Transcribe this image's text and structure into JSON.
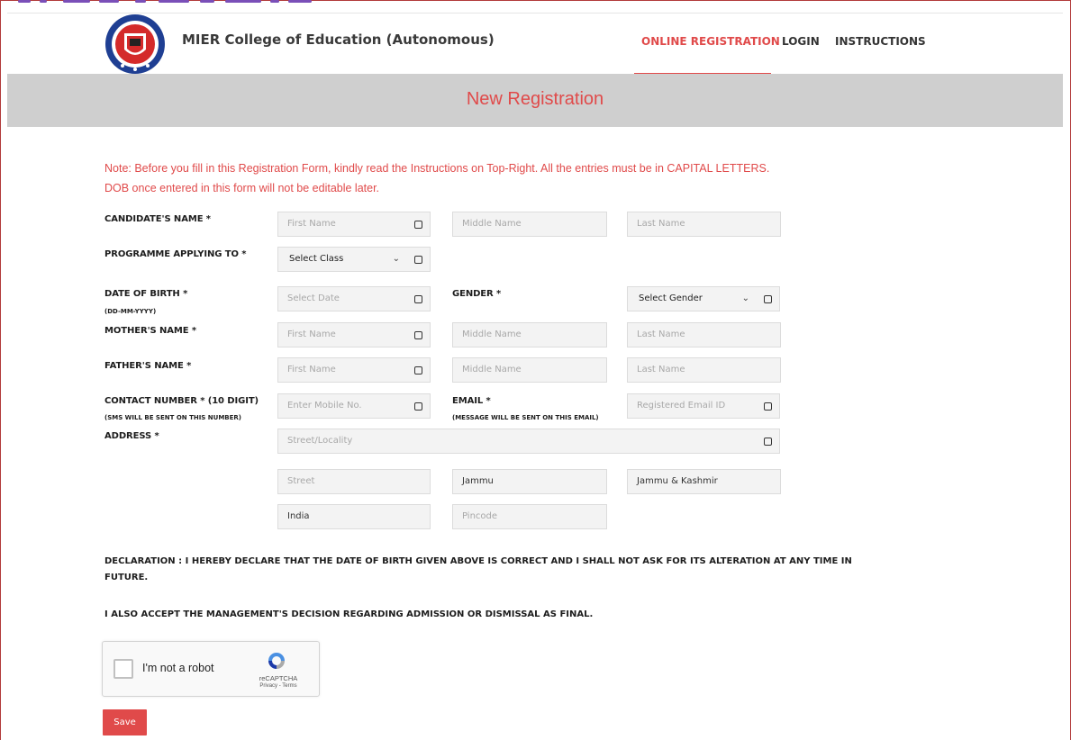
{
  "header": {
    "brand": "MIER College of Education (Autonomous)",
    "nav": [
      {
        "label": "ONLINE REGISTRATION",
        "active": true
      },
      {
        "label": "LOGIN",
        "active": false
      },
      {
        "label": "INSTRUCTIONS",
        "active": false
      }
    ]
  },
  "banner": {
    "title": "New Registration"
  },
  "note": {
    "line1": "Note: Before you fill in this Registration Form, kindly read the Instructions on Top-Right. All the entries must be in CAPITAL LETTERS.",
    "line2": "DOB once entered in this form will not be editable later."
  },
  "form": {
    "candidate": {
      "label": "CANDIDATE'S NAME *",
      "first": "First Name",
      "middle": "Middle Name",
      "last": "Last Name"
    },
    "programme": {
      "label": "PROGRAMME APPLYING TO *",
      "selected": "Select Class"
    },
    "dob": {
      "label": "DATE OF BIRTH *",
      "sublabel": "(DD-MM-YYYY)",
      "placeholder": "Select Date"
    },
    "gender": {
      "label": "GENDER *",
      "selected": "Select Gender"
    },
    "mother": {
      "label": "MOTHER'S NAME *",
      "first": "First Name",
      "middle": "Middle Name",
      "last": "Last Name"
    },
    "father": {
      "label": "FATHER'S NAME *",
      "first": "First Name",
      "middle": "Middle Name",
      "last": "Last Name"
    },
    "contact": {
      "label": "CONTACT NUMBER * (10 DIGIT)",
      "sublabel": "(SMS WILL BE SENT ON THIS NUMBER)",
      "placeholder": "Enter Mobile No."
    },
    "email": {
      "label": "EMAIL *",
      "sublabel": "(MESSAGE WILL BE SENT ON THIS EMAIL)",
      "placeholder": "Registered Email ID"
    },
    "address": {
      "label": "ADDRESS *",
      "locality_placeholder": "Street/Locality",
      "street_placeholder": "Street",
      "city": "Jammu",
      "state": "Jammu & Kashmir",
      "country": "India",
      "pincode_placeholder": "Pincode"
    }
  },
  "declaration": {
    "line1": "DECLARATION : I HEREBY DECLARE THAT THE DATE OF BIRTH GIVEN ABOVE IS CORRECT AND I SHALL NOT ASK FOR ITS ALTERATION AT ANY TIME IN",
    "line2": "FUTURE.",
    "accept": "I ALSO ACCEPT THE MANAGEMENT'S DECISION REGARDING ADMISSION OR DISMISSAL AS FINAL."
  },
  "captcha": {
    "label": "I'm not a robot",
    "brand": "reCAPTCHA",
    "links": "Privacy - Terms"
  },
  "save_label": "Save",
  "colors": {
    "accent": "#e04a4a",
    "banner": "#cfcfcf",
    "field_bg": "#f3f3f3"
  }
}
